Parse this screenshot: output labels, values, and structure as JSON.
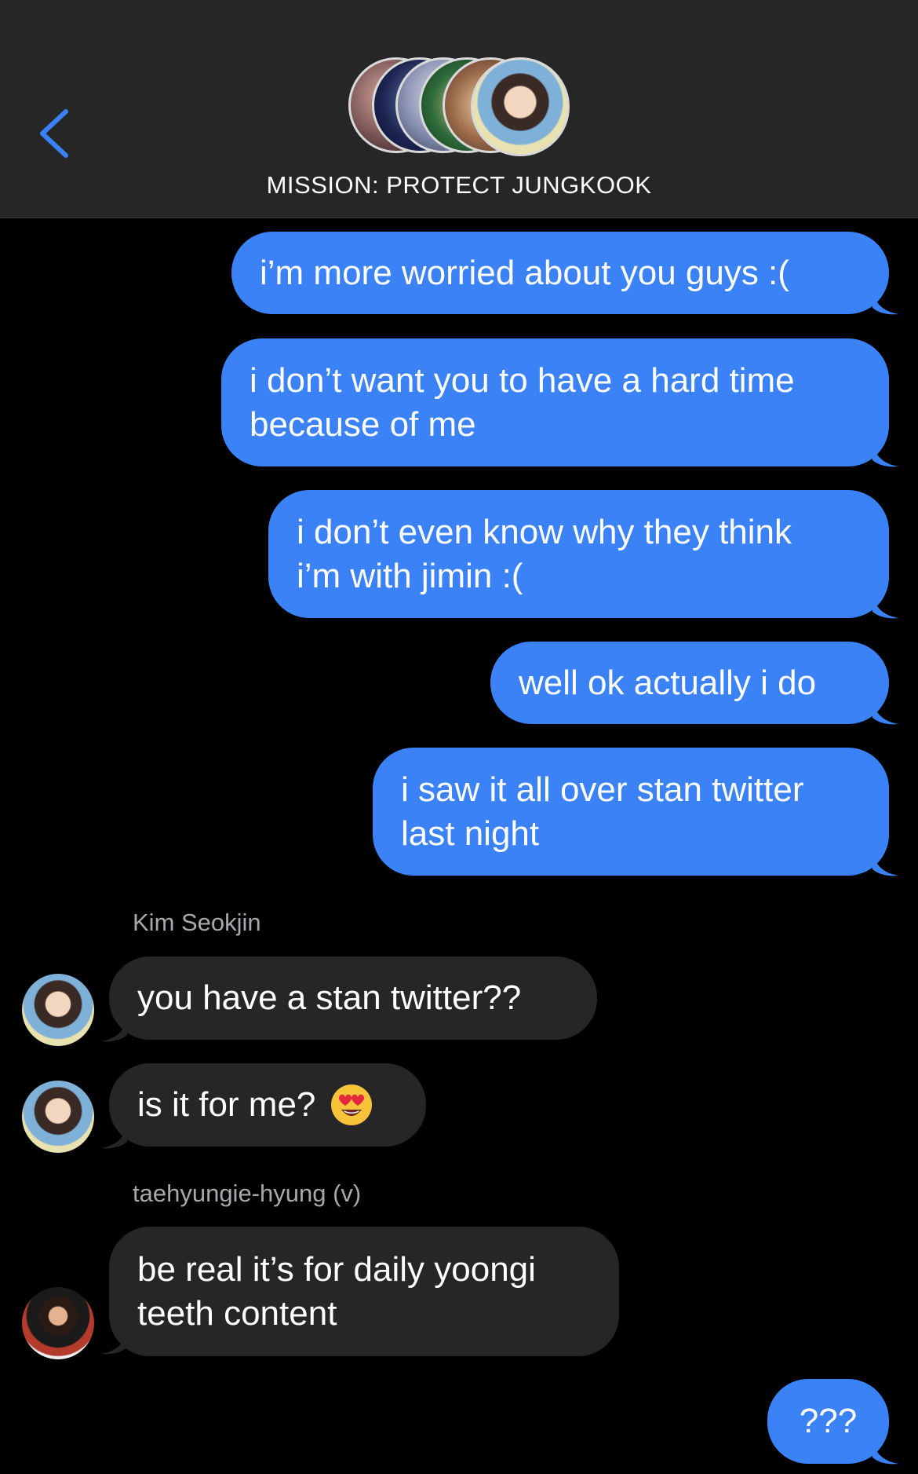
{
  "header": {
    "title": "MISSION: PROTECT JUNGKOOK",
    "back_icon": "chevron-left-icon",
    "accent_color": "#3b82f6"
  },
  "colors": {
    "outgoing_bubble": "#3b82f6",
    "incoming_bubble": "#262628",
    "background": "#000000",
    "header_bg": "#262626"
  },
  "messages": [
    {
      "direction": "out",
      "text": "i’m more worried about you guys :("
    },
    {
      "direction": "out",
      "text": "i don’t want you to have a hard time\nbecause of me"
    },
    {
      "direction": "out",
      "text": "i don’t even know why they think\ni’m with jimin :("
    },
    {
      "direction": "out",
      "text": "well ok actually i do"
    },
    {
      "direction": "out",
      "text": "i saw it all over stan twitter\nlast night"
    },
    {
      "direction": "sender",
      "text": "Kim Seokjin"
    },
    {
      "direction": "in",
      "text": "you have a stan twitter??"
    },
    {
      "direction": "in",
      "text": "is it for me?",
      "emoji": "heart-eyes-emoji"
    },
    {
      "direction": "sender",
      "text": "taehyungie-hyung (v)"
    },
    {
      "direction": "in",
      "text": "be real it’s for daily yoongi\nteeth content"
    },
    {
      "direction": "out",
      "text": "???"
    }
  ]
}
